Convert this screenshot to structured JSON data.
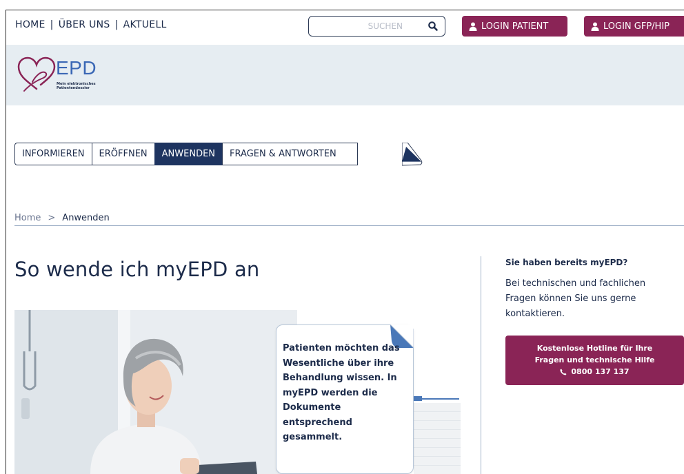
{
  "topnav": {
    "items": [
      "HOME",
      "ÜBER UNS",
      "AKTUELL"
    ],
    "separator": "|"
  },
  "search": {
    "placeholder": "SUCHEN",
    "icon": "search-icon"
  },
  "login": {
    "patient_label": "LOGIN PATIENT",
    "gfp_label": "LOGIN GFP/HIP",
    "icon": "user-icon",
    "color": "#8a2456"
  },
  "logo": {
    "title": "EPD",
    "subtitle_line1": "Mein elektronisches",
    "subtitle_line2": "Patientendossier",
    "heart_color": "#8a2456",
    "text_color": "#3a67b5"
  },
  "tabs": [
    {
      "label": "INFORMIEREN",
      "active": false
    },
    {
      "label": "ERÖFFNEN",
      "active": false
    },
    {
      "label": "ANWENDEN",
      "active": true
    },
    {
      "label": "FRAGEN & ANTWORTEN",
      "active": false
    }
  ],
  "breadcrumb": {
    "home": "Home",
    "separator": ">",
    "current": "Anwenden"
  },
  "main": {
    "headline": "So wende ich myEPD an",
    "card_text": "Patienten möchten das Wesentliche über ihre Behandlung wissen. In myEPD werden die Dokumente entsprechend gesammelt."
  },
  "sidebar": {
    "title": "Sie haben bereits myEPD?",
    "text": "Bei technischen und fachlichen Fragen können Sie uns gerne kontaktieren.",
    "hotline_line1": "Kostenlose Hotline für Ihre",
    "hotline_line2": "Fragen und technische Hilfe",
    "hotline_phone": "0800 137 137",
    "phone_icon": "phone-icon"
  },
  "colors": {
    "navy": "#1e3460",
    "accent": "#8a2456",
    "band": "#e6edf2"
  }
}
